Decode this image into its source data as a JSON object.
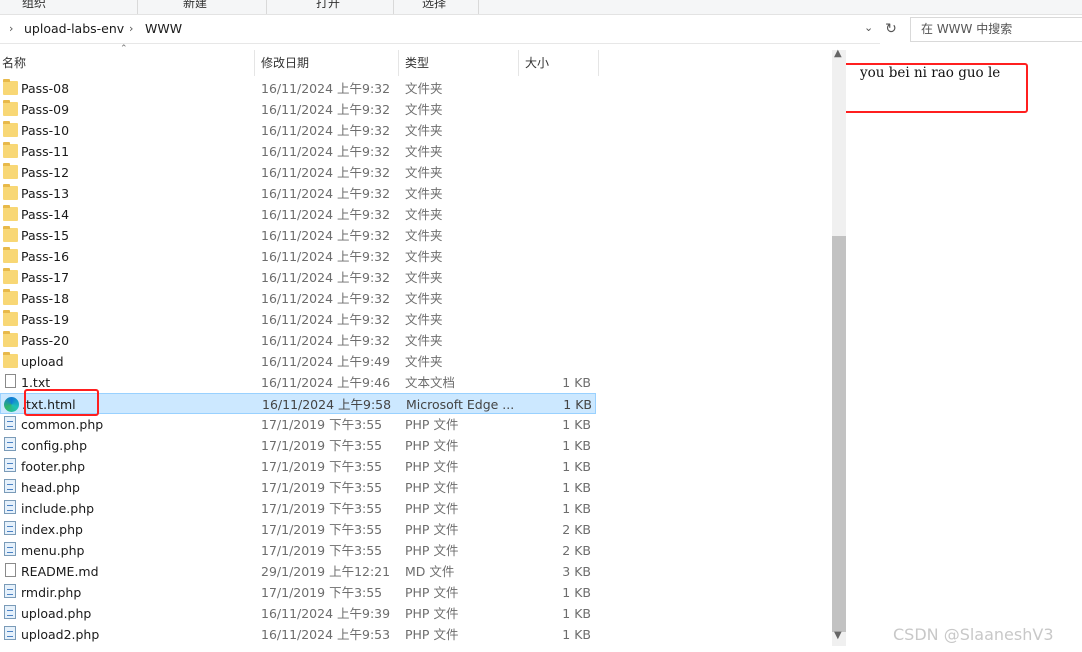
{
  "ribbon": {
    "groups": [
      "组织",
      "新建",
      "打开",
      "选择"
    ]
  },
  "address": {
    "path": [
      "upload-labs-env",
      "WWW"
    ]
  },
  "search": {
    "placeholder": "在 WWW 中搜索"
  },
  "columns": {
    "name": "名称",
    "date": "修改日期",
    "type": "类型",
    "size": "大小"
  },
  "files": [
    {
      "name": "Pass-08",
      "date": "16/11/2024 上午9:32",
      "type": "文件夹",
      "size": "",
      "icon": "folder-icon"
    },
    {
      "name": "Pass-09",
      "date": "16/11/2024 上午9:32",
      "type": "文件夹",
      "size": "",
      "icon": "folder-icon"
    },
    {
      "name": "Pass-10",
      "date": "16/11/2024 上午9:32",
      "type": "文件夹",
      "size": "",
      "icon": "folder-icon"
    },
    {
      "name": "Pass-11",
      "date": "16/11/2024 上午9:32",
      "type": "文件夹",
      "size": "",
      "icon": "folder-icon"
    },
    {
      "name": "Pass-12",
      "date": "16/11/2024 上午9:32",
      "type": "文件夹",
      "size": "",
      "icon": "folder-icon"
    },
    {
      "name": "Pass-13",
      "date": "16/11/2024 上午9:32",
      "type": "文件夹",
      "size": "",
      "icon": "folder-icon"
    },
    {
      "name": "Pass-14",
      "date": "16/11/2024 上午9:32",
      "type": "文件夹",
      "size": "",
      "icon": "folder-icon"
    },
    {
      "name": "Pass-15",
      "date": "16/11/2024 上午9:32",
      "type": "文件夹",
      "size": "",
      "icon": "folder-icon"
    },
    {
      "name": "Pass-16",
      "date": "16/11/2024 上午9:32",
      "type": "文件夹",
      "size": "",
      "icon": "folder-icon"
    },
    {
      "name": "Pass-17",
      "date": "16/11/2024 上午9:32",
      "type": "文件夹",
      "size": "",
      "icon": "folder-icon"
    },
    {
      "name": "Pass-18",
      "date": "16/11/2024 上午9:32",
      "type": "文件夹",
      "size": "",
      "icon": "folder-icon"
    },
    {
      "name": "Pass-19",
      "date": "16/11/2024 上午9:32",
      "type": "文件夹",
      "size": "",
      "icon": "folder-icon"
    },
    {
      "name": "Pass-20",
      "date": "16/11/2024 上午9:32",
      "type": "文件夹",
      "size": "",
      "icon": "folder-icon"
    },
    {
      "name": "upload",
      "date": "16/11/2024 上午9:49",
      "type": "文件夹",
      "size": "",
      "icon": "folder-icon"
    },
    {
      "name": "1.txt",
      "date": "16/11/2024 上午9:46",
      "type": "文本文档",
      "size": "1 KB",
      "icon": "text-file-icon"
    },
    {
      "name": ".txt.html",
      "date": "16/11/2024 上午9:58",
      "type": "Microsoft Edge ...",
      "size": "1 KB",
      "icon": "edge-icon",
      "selected": true
    },
    {
      "name": "common.php",
      "date": "17/1/2019 下午3:55",
      "type": "PHP 文件",
      "size": "1 KB",
      "icon": "php-file-icon"
    },
    {
      "name": "config.php",
      "date": "17/1/2019 下午3:55",
      "type": "PHP 文件",
      "size": "1 KB",
      "icon": "php-file-icon"
    },
    {
      "name": "footer.php",
      "date": "17/1/2019 下午3:55",
      "type": "PHP 文件",
      "size": "1 KB",
      "icon": "php-file-icon"
    },
    {
      "name": "head.php",
      "date": "17/1/2019 下午3:55",
      "type": "PHP 文件",
      "size": "1 KB",
      "icon": "php-file-icon"
    },
    {
      "name": "include.php",
      "date": "17/1/2019 下午3:55",
      "type": "PHP 文件",
      "size": "1 KB",
      "icon": "php-file-icon"
    },
    {
      "name": "index.php",
      "date": "17/1/2019 下午3:55",
      "type": "PHP 文件",
      "size": "2 KB",
      "icon": "php-file-icon"
    },
    {
      "name": "menu.php",
      "date": "17/1/2019 下午3:55",
      "type": "PHP 文件",
      "size": "2 KB",
      "icon": "php-file-icon"
    },
    {
      "name": "README.md",
      "date": "29/1/2019 上午12:21",
      "type": "MD 文件",
      "size": "3 KB",
      "icon": "text-file-icon"
    },
    {
      "name": "rmdir.php",
      "date": "17/1/2019 下午3:55",
      "type": "PHP 文件",
      "size": "1 KB",
      "icon": "php-file-icon"
    },
    {
      "name": "upload.php",
      "date": "16/11/2024 上午9:39",
      "type": "PHP 文件",
      "size": "1 KB",
      "icon": "php-file-icon"
    },
    {
      "name": "upload2.php",
      "date": "16/11/2024 上午9:53",
      "type": "PHP 文件",
      "size": "1 KB",
      "icon": "php-file-icon"
    }
  ],
  "preview": {
    "text": "you bei ni rao guo le"
  },
  "watermark": "CSDN @SlaaneshV3",
  "colors": {
    "selection_bg": "#cce8ff",
    "selection_border": "#99d1ff",
    "annotation_red": "#ff1f1f",
    "folder": "#f8d775"
  }
}
